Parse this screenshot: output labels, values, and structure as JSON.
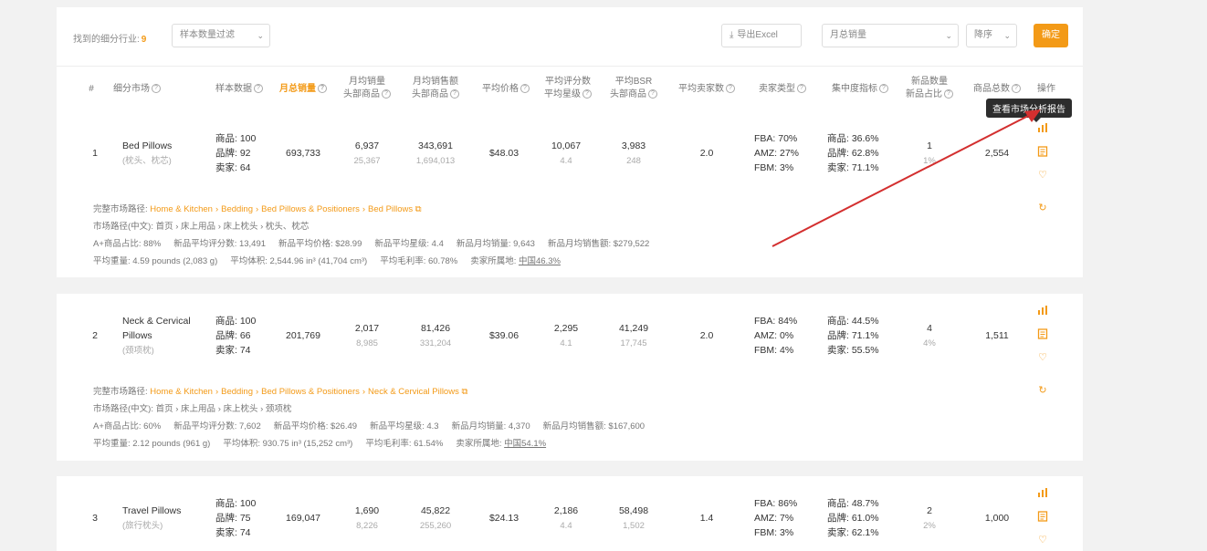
{
  "toolbar": {
    "found_label": "找到的细分行业:",
    "found_count": "9",
    "sample_filter": "样本数量过滤",
    "export_label": "导出Excel",
    "metric_select": "月总销量",
    "order_select": "降序",
    "confirm_label": "确定"
  },
  "headers": {
    "index": "#",
    "market": "细分市场",
    "sample": "样本数据",
    "monthly_sales": "月总销量",
    "avg_sales_1": "月均销量",
    "avg_sales_2": "头部商品",
    "avg_revenue_1": "月均销售额",
    "avg_revenue_2": "头部商品",
    "avg_price": "平均价格",
    "avg_review_1": "平均评分数",
    "avg_review_2": "平均星级",
    "avg_bsr_1": "平均BSR",
    "avg_bsr_2": "头部商品",
    "avg_sellers": "平均卖家数",
    "seller_type": "卖家类型",
    "concentration": "集中度指标",
    "new_count_1": "新品数量",
    "new_count_2": "新品占比",
    "total_products": "商品总数",
    "actions": "操作"
  },
  "tooltip": "查看市场分析报告",
  "rows": [
    {
      "index": "1",
      "name_en": "Bed Pillows",
      "name_cn": "(枕头、枕芯)",
      "sample": [
        "商品: 100",
        "品牌: 92",
        "卖家: 64"
      ],
      "monthly_sales": "693,733",
      "avg_sales": "6,937",
      "avg_sales_top": "25,367",
      "avg_revenue": "343,691",
      "avg_revenue_top": "1,694,013",
      "avg_price": "$48.03",
      "avg_reviews": "10,067",
      "avg_rating": "4.4",
      "avg_bsr": "3,983",
      "avg_bsr_top": "248",
      "avg_sellers": "2.0",
      "seller_type": [
        "FBA: 70%",
        "AMZ: 27%",
        "FBM: 3%"
      ],
      "concentration": [
        "商品: 36.6%",
        "品牌: 62.8%",
        "卖家: 71.1%"
      ],
      "new_count": "1",
      "new_ratio": "1%",
      "total_products": "2,554",
      "path_label": "完整市场路径:",
      "path": [
        "Home & Kitchen",
        "Bedding",
        "Bed Pillows & Positioners",
        "Bed Pillows"
      ],
      "path_cn": "市场路径(中文): 首页 › 床上用品 › 床上枕头 › 枕头、枕芯",
      "stats": [
        "A+商品占比: 88%",
        "新品平均评分数: 13,491",
        "新品平均价格: $28.99",
        "新品平均星级: 4.4",
        "新品月均销量: 9,643",
        "新品月均销售额: $279,522"
      ],
      "stats2_weight": "平均重量: 4.59 pounds (2,083 g)",
      "stats2_volume": "平均体积: 2,544.96 in³ (41,704 cm³)",
      "stats2_margin": "平均毛利率: 60.78%",
      "stats2_origin_label": "卖家所属地:",
      "stats2_origin": "中国46.3%"
    },
    {
      "index": "2",
      "name_en": "Neck & Cervical",
      "name_en2": "Pillows",
      "name_cn": "(颈项枕)",
      "sample": [
        "商品: 100",
        "品牌: 66",
        "卖家: 74"
      ],
      "monthly_sales": "201,769",
      "avg_sales": "2,017",
      "avg_sales_top": "8,985",
      "avg_revenue": "81,426",
      "avg_revenue_top": "331,204",
      "avg_price": "$39.06",
      "avg_reviews": "2,295",
      "avg_rating": "4.1",
      "avg_bsr": "41,249",
      "avg_bsr_top": "17,745",
      "avg_sellers": "2.0",
      "seller_type": [
        "FBA: 84%",
        "AMZ: 0%",
        "FBM: 4%"
      ],
      "concentration": [
        "商品: 44.5%",
        "品牌: 71.1%",
        "卖家: 55.5%"
      ],
      "new_count": "4",
      "new_ratio": "4%",
      "total_products": "1,511",
      "path_label": "完整市场路径:",
      "path": [
        "Home & Kitchen",
        "Bedding",
        "Bed Pillows & Positioners",
        "Neck & Cervical Pillows"
      ],
      "path_cn": "市场路径(中文): 首页 › 床上用品 › 床上枕头 › 颈项枕",
      "stats": [
        "A+商品占比: 60%",
        "新品平均评分数: 7,602",
        "新品平均价格: $26.49",
        "新品平均星级: 4.3",
        "新品月均销量: 4,370",
        "新品月均销售额: $167,600"
      ],
      "stats2_weight": "平均重量: 2.12 pounds (961 g)",
      "stats2_volume": "平均体积: 930.75 in³ (15,252 cm³)",
      "stats2_margin": "平均毛利率: 61.54%",
      "stats2_origin_label": "卖家所属地:",
      "stats2_origin": "中国54.1%"
    },
    {
      "index": "3",
      "name_en": "Travel Pillows",
      "name_cn": "(旅行枕头)",
      "sample": [
        "商品: 100",
        "品牌: 75",
        "卖家: 74"
      ],
      "monthly_sales": "169,047",
      "avg_sales": "1,690",
      "avg_sales_top": "8,226",
      "avg_revenue": "45,822",
      "avg_revenue_top": "255,260",
      "avg_price": "$24.13",
      "avg_reviews": "2,186",
      "avg_rating": "4.4",
      "avg_bsr": "58,498",
      "avg_bsr_top": "1,502",
      "avg_sellers": "1.4",
      "seller_type": [
        "FBA: 86%",
        "AMZ: 7%",
        "FBM: 3%"
      ],
      "concentration": [
        "商品: 48.7%",
        "品牌: 61.0%",
        "卖家: 62.1%"
      ],
      "new_count": "2",
      "new_ratio": "2%",
      "total_products": "1,000"
    }
  ],
  "colors": {
    "accent": "#f39a17",
    "arrow": "#d32f2f",
    "tooltip_bg": "#2d2d2d"
  }
}
